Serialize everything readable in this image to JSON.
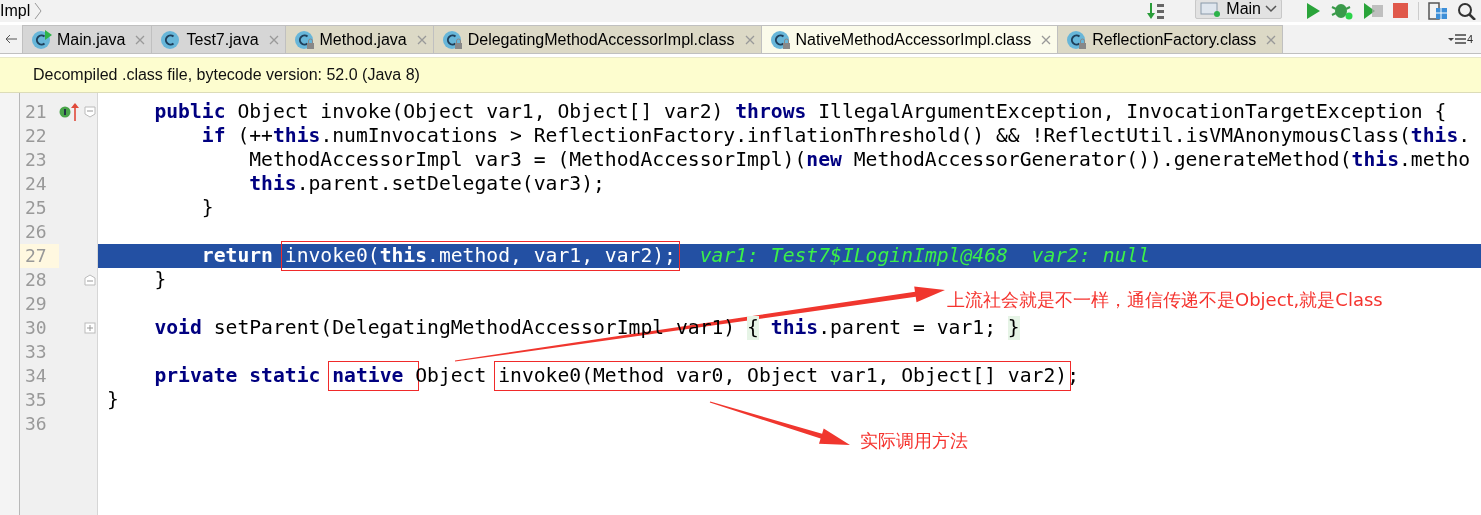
{
  "breadcrumb": {
    "label": "Impl"
  },
  "toolbar": {
    "run_configuration": "Main"
  },
  "tabs": [
    {
      "label": "Main.java",
      "kind": "run",
      "selected": false
    },
    {
      "label": "Test7.java",
      "kind": "source",
      "selected": false
    },
    {
      "label": "Method.java",
      "kind": "locked",
      "selected": false
    },
    {
      "label": "DelegatingMethodAccessorImpl.class",
      "kind": "locked",
      "selected": false
    },
    {
      "label": "NativeMethodAccessorImpl.class",
      "kind": "locked",
      "selected": true
    },
    {
      "label": "ReflectionFactory.class",
      "kind": "locked",
      "selected": false
    }
  ],
  "tab_overflow": {
    "count": "4"
  },
  "banner": {
    "text": "Decompiled .class file, bytecode version: 52.0 (Java 8)"
  },
  "editor": {
    "lines": [
      {
        "number": "21",
        "kind": "opener",
        "current": false,
        "markers": true,
        "segments": [
          {
            "kind": "kw",
            "text": "    public"
          },
          {
            "kind": "plain",
            "text": " Object invoke(Object var1, Object[] var2) "
          },
          {
            "kind": "kw",
            "text": "throws"
          },
          {
            "kind": "plain",
            "text": " IllegalArgumentException, InvocationTargetException {"
          }
        ]
      },
      {
        "number": "22",
        "kind": "plain",
        "current": false,
        "markers": false,
        "segments": [
          {
            "kind": "kw",
            "text": "        if"
          },
          {
            "kind": "plain",
            "text": " (++"
          },
          {
            "kind": "kw",
            "text": "this"
          },
          {
            "kind": "plain",
            "text": ".numInvocations > ReflectionFactory.inflationThreshold() && !ReflectUtil.isVMAnonymousClass("
          },
          {
            "kind": "kw",
            "text": "this"
          },
          {
            "kind": "plain",
            "text": "."
          }
        ]
      },
      {
        "number": "23",
        "kind": "plain",
        "current": false,
        "markers": false,
        "segments": [
          {
            "kind": "plain",
            "text": "            MethodAccessorImpl var3 = (MethodAccessorImpl)("
          },
          {
            "kind": "kw",
            "text": "new"
          },
          {
            "kind": "plain",
            "text": " MethodAccessorGenerator()).generateMethod("
          },
          {
            "kind": "kw",
            "text": "this"
          },
          {
            "kind": "plain",
            "text": ".metho"
          }
        ]
      },
      {
        "number": "24",
        "kind": "plain",
        "current": false,
        "markers": false,
        "segments": [
          {
            "kind": "kw",
            "text": "            this"
          },
          {
            "kind": "plain",
            "text": ".parent.setDelegate(var3);"
          }
        ]
      },
      {
        "number": "25",
        "kind": "plain",
        "current": false,
        "markers": false,
        "segments": [
          {
            "kind": "plain",
            "text": "        }"
          }
        ]
      },
      {
        "number": "26",
        "kind": "plain",
        "current": false,
        "markers": false
      },
      {
        "number": "27",
        "kind": "plain",
        "current": true,
        "markers": false,
        "segments": [
          {
            "kind": "kw",
            "text": "        return "
          },
          {
            "kind": "box",
            "segments": [
              {
                "kind": "plain",
                "text": "invoke0("
              },
              {
                "kind": "kw",
                "text": "this"
              },
              {
                "kind": "plain",
                "text": ".method, var1, var2);"
              }
            ]
          },
          {
            "kind": "hint",
            "text": "  var1: Test7$ILoginImpl@468  var2: null"
          }
        ]
      },
      {
        "number": "28",
        "kind": "closer",
        "current": false,
        "markers": false,
        "segments": [
          {
            "kind": "plain",
            "text": "    }"
          }
        ]
      },
      {
        "number": "29",
        "kind": "plain",
        "current": false,
        "markers": false
      },
      {
        "number": "30",
        "kind": "folded",
        "current": false,
        "markers": false,
        "segments": [
          {
            "kind": "kw",
            "text": "    void"
          },
          {
            "kind": "plain",
            "text": " setParent(DelegatingMethodAccessorImpl var1) "
          },
          {
            "kind": "fold",
            "text": "{"
          },
          {
            "kind": "kw",
            "text": " this"
          },
          {
            "kind": "plain",
            "text": ".parent = var1; "
          },
          {
            "kind": "fold",
            "text": "}"
          }
        ]
      },
      {
        "number": "33",
        "kind": "plain",
        "current": false,
        "markers": false
      },
      {
        "number": "34",
        "kind": "plain",
        "current": false,
        "markers": false,
        "segments": [
          {
            "kind": "kw",
            "text": "    private static "
          },
          {
            "kind": "box",
            "segments": [
              {
                "kind": "kw",
                "text": "native "
              }
            ]
          },
          {
            "kind": "plain",
            "text": "Object "
          },
          {
            "kind": "box",
            "segments": [
              {
                "kind": "plain",
                "text": "invoke0(Method var0, Object var1, Object[] var2)"
              }
            ]
          },
          {
            "kind": "plain",
            "text": ";"
          }
        ]
      },
      {
        "number": "35",
        "kind": "plain",
        "current": false,
        "markers": false,
        "segments": [
          {
            "kind": "plain",
            "text": "}"
          }
        ]
      },
      {
        "number": "36",
        "kind": "plain",
        "current": false,
        "markers": false
      }
    ]
  },
  "annotations": [
    {
      "text": "上流社会就是不一样，通信传递不是Object,就是Class"
    },
    {
      "text": "实际调用方法"
    }
  ]
}
